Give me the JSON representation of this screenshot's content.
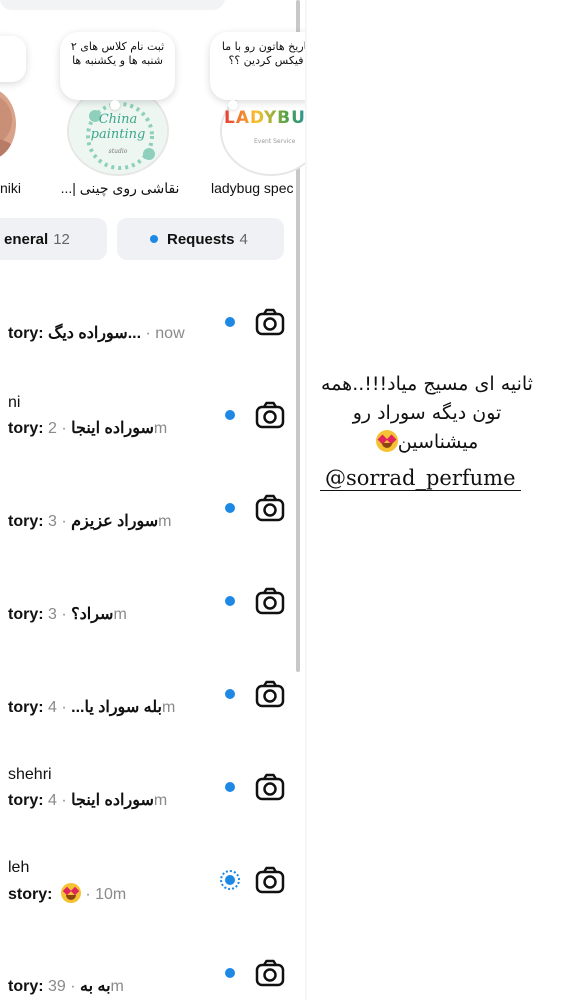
{
  "notes": [
    {
      "text": ""
    },
    {
      "text": "ثبت نام کلاس های ۲ شنبه ها و یکشنبه ها"
    },
    {
      "text": "تاریخ هاتون رو با ما فیکس کردین ؟؟"
    }
  ],
  "stories": [
    {
      "name": "niki"
    },
    {
      "name": "نقاشی روی چینی |...",
      "logo_text": "China painting",
      "logo_sub": "studio"
    },
    {
      "name": "ladybug spec",
      "logo_text": "LADYBUG",
      "logo_sub": "Event Service"
    }
  ],
  "tabs": {
    "general": {
      "label": "eneral",
      "count": "12"
    },
    "requests": {
      "label": "Requests",
      "count": "4"
    }
  },
  "rows": [
    {
      "name": "",
      "preview": "tory: سوراده دیگ...",
      "time": "· now",
      "status": "dot"
    },
    {
      "name": "ni",
      "preview": "tory: سوراده اینجا",
      "time": "· 2m",
      "status": "dot"
    },
    {
      "name": "",
      "preview": "tory: سوراد عزیزم",
      "time": "· 3m",
      "status": "dot"
    },
    {
      "name": "",
      "preview": "tory: سراد؟",
      "time": "· 3m",
      "status": "dot"
    },
    {
      "name": "",
      "preview": "tory: بله سوراد یا...",
      "time": "· 4m",
      "status": "dot"
    },
    {
      "name": "shehri",
      "preview": "tory: سوراده اینجا",
      "time": "· 4m",
      "status": "dot"
    },
    {
      "name": "leh",
      "preview": "story:",
      "time": "· 10m",
      "status": "ring",
      "emoji": "heart-eyes"
    },
    {
      "name": "",
      "preview": "tory: به به",
      "time": "· 39m",
      "status": "dot"
    }
  ],
  "caption": {
    "line1": "ثانیه ای مسیج میاد!!!..همه",
    "line2": "تون دیگه سوراد رو",
    "line3": "میشناسین",
    "handle": "@sorrad_perfume"
  },
  "colors": {
    "accent": "#1e88e5",
    "tab_bg": "#eff1f4",
    "muted": "#8a8a8a"
  }
}
